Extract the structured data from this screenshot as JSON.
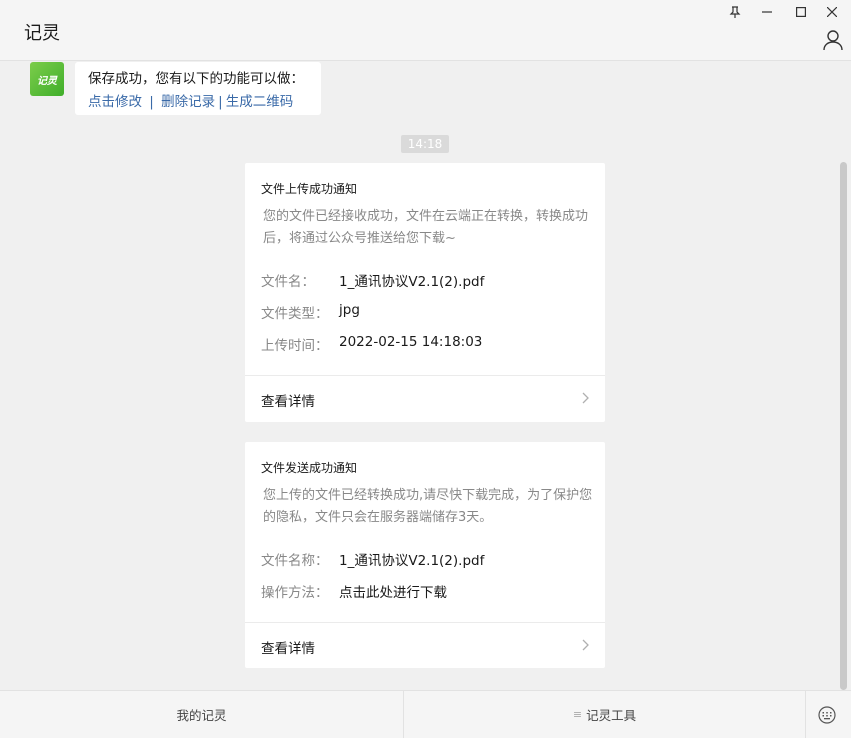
{
  "window": {
    "title": "记灵",
    "pin_glyph": "⊥",
    "min_glyph": "—",
    "max_glyph": "☐",
    "close_glyph": "✕"
  },
  "chat": {
    "avatar_text": "记灵",
    "message": {
      "text": "保存成功，您有以下的功能可以做：",
      "links": [
        "点击修改",
        "删除记录",
        "生成二维码"
      ],
      "separator": "|"
    },
    "timestamp": "14:18"
  },
  "cards": [
    {
      "title": "文件上传成功通知",
      "description": "您的文件已经接收成功，文件在云端正在转换，转换成功后，将通过公众号推送给您下载~",
      "rows": [
        {
          "label": "文件名：",
          "value": "1_通讯协议V2.1(2).pdf"
        },
        {
          "label": "文件类型：",
          "value": "jpg"
        },
        {
          "label": "上传时间：",
          "value": "2022-02-15 14:18:03"
        }
      ],
      "footer": "查看详情"
    },
    {
      "title": "文件发送成功通知",
      "description": "您上传的文件已经转换成功,请尽快下载完成，为了保护您的隐私，文件只会在服务器端储存3天。",
      "rows": [
        {
          "label": "文件名称：",
          "value": "1_通讯协议V2.1(2).pdf"
        },
        {
          "label": "操作方法：",
          "value": "点击此处进行下载"
        }
      ],
      "footer": "查看详情"
    }
  ],
  "menu": {
    "items": [
      "我的记灵",
      "记灵工具"
    ],
    "menu_glyph": "≡"
  },
  "colors": {
    "link": "#3a6aa8",
    "brand": "#3fae2a",
    "muted": "#888888"
  }
}
